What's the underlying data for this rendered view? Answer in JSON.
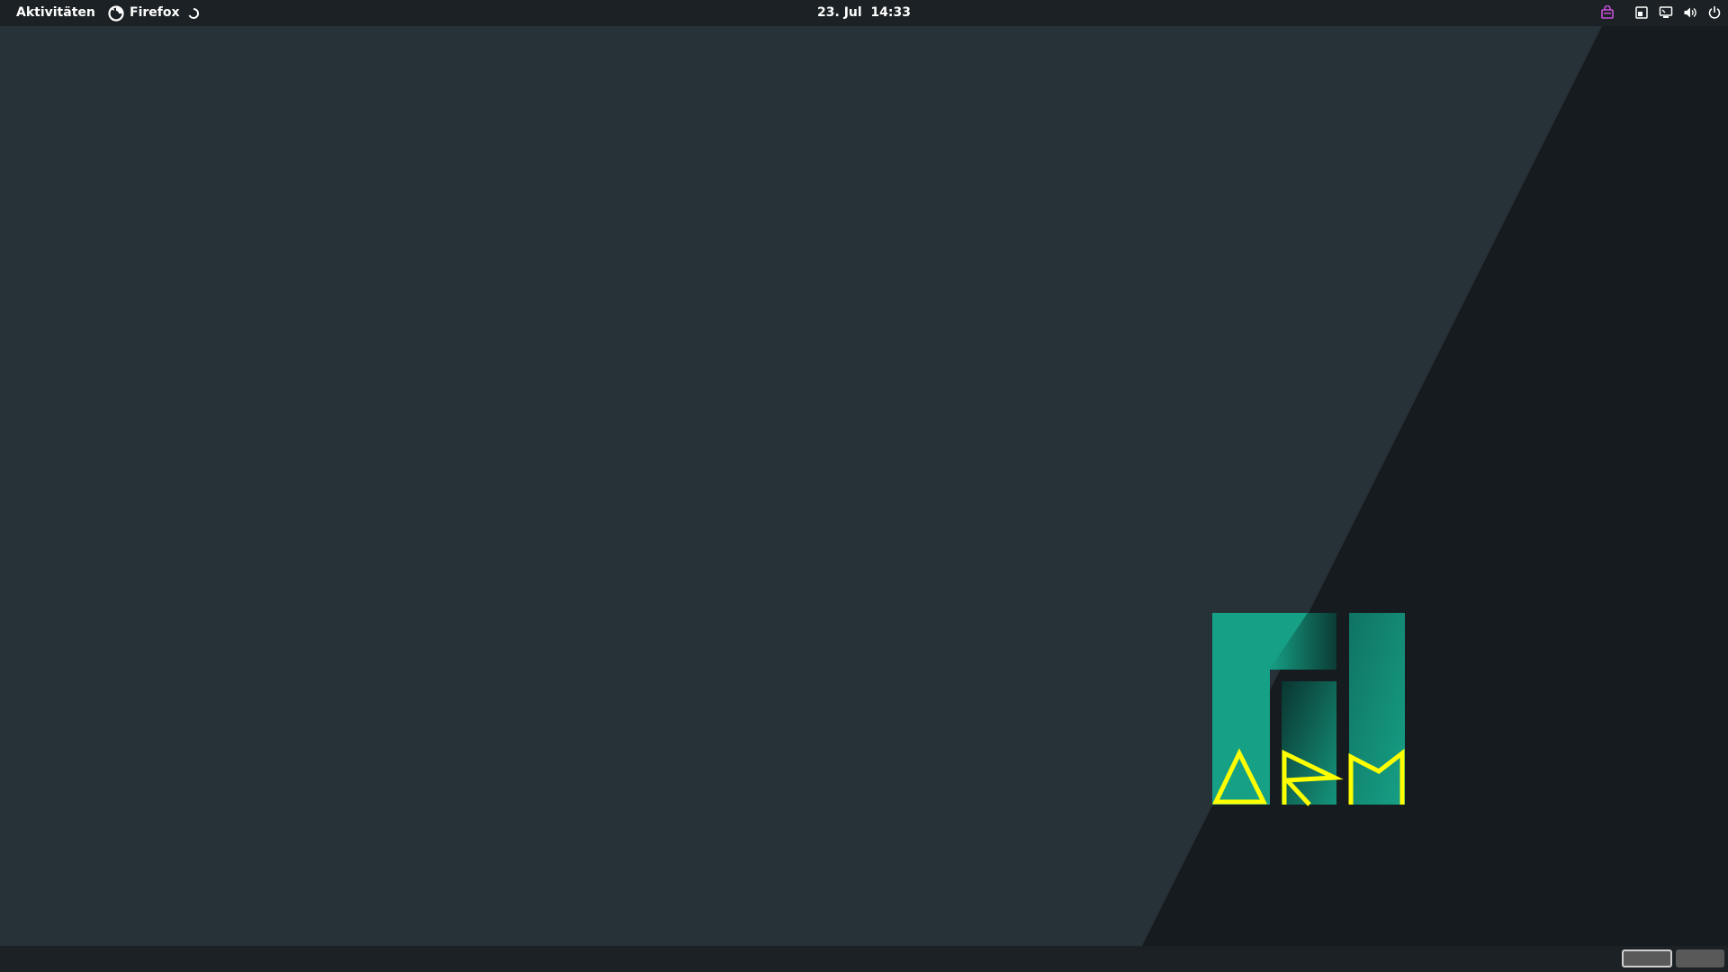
{
  "topbar": {
    "activities_label": "Aktivitäten",
    "app_name": "Firefox",
    "clock": "23. Jul  14:33"
  },
  "tray": {
    "icons": [
      "shopping-bag-icon",
      "screen-share-icon",
      "network-wired-icon",
      "volume-icon",
      "power-icon"
    ],
    "accent_color": "#c84fd9"
  },
  "desktop": {
    "wallpaper_colors": {
      "background": "#263238",
      "shadow": "#151b1e",
      "logo_green": "#16a085",
      "logo_yellow": "#ffff00"
    }
  },
  "workspaces": {
    "count": 2,
    "active_index": 0
  }
}
